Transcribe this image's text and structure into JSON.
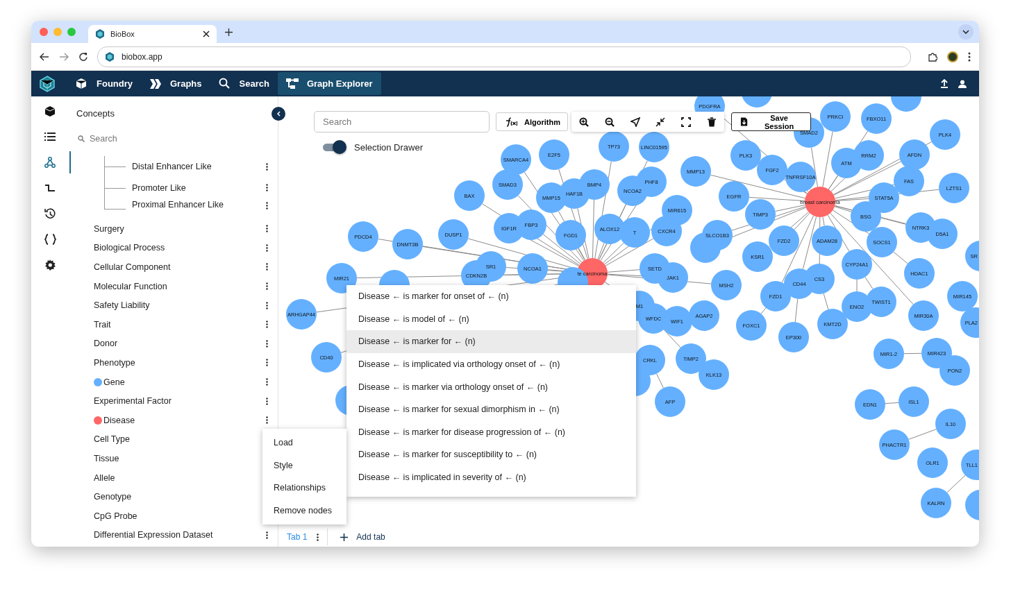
{
  "browser": {
    "tab_title": "BioBox",
    "url": "biobox.app"
  },
  "nav": {
    "items": [
      {
        "label": "Foundry",
        "selected": false
      },
      {
        "label": "Graphs",
        "selected": false
      },
      {
        "label": "Search",
        "selected": false
      },
      {
        "label": "Graph Explorer",
        "selected": true
      }
    ]
  },
  "concepts": {
    "title": "Concepts",
    "search_placeholder": "Search",
    "items": [
      {
        "children": [
          {
            "label": "Distal Enhancer Like"
          },
          {
            "label": "Promoter Like"
          },
          {
            "label": "Proximal Enhancer Like"
          }
        ]
      },
      {
        "label": "Surgery"
      },
      {
        "label": "Biological Process"
      },
      {
        "label": "Cellular Component"
      },
      {
        "label": "Molecular Function"
      },
      {
        "label": "Safety Liability"
      },
      {
        "label": "Trait"
      },
      {
        "label": "Donor"
      },
      {
        "label": "Phenotype"
      },
      {
        "label": "Gene",
        "color": "#64b0ff"
      },
      {
        "label": "Experimental Factor"
      },
      {
        "label": "Disease",
        "color": "#ff6666"
      },
      {
        "label": "Cell Type"
      },
      {
        "label": "Tissue"
      },
      {
        "label": "Allele"
      },
      {
        "label": "Genotype"
      },
      {
        "label": "CpG Probe"
      },
      {
        "label": "Differential Expression Dataset"
      }
    ]
  },
  "graph": {
    "search_placeholder": "Search",
    "algorithm_button": "Algorithm",
    "save_button": "Save Session",
    "selection_drawer": {
      "label": "Selection Drawer",
      "on": true
    },
    "nodes": [
      {
        "label": "te carcinoma",
        "color": "#ff6666"
      },
      {
        "label": "breast carcinoma",
        "color": "#ff6666"
      },
      {
        "label": "SMARCA4",
        "color": "#64b0ff"
      },
      {
        "label": "E2F5",
        "color": "#64b0ff"
      },
      {
        "label": "TP73",
        "color": "#64b0ff"
      },
      {
        "label": "SMAD3",
        "color": "#64b0ff"
      },
      {
        "label": "BAX",
        "color": "#64b0ff"
      },
      {
        "label": "MMP15",
        "color": "#64b0ff"
      },
      {
        "label": "HAF1B",
        "color": "#64b0ff"
      },
      {
        "label": "BMP4",
        "color": "#64b0ff"
      },
      {
        "label": "NCOA2",
        "color": "#64b0ff"
      },
      {
        "label": "IGF1R",
        "color": "#64b0ff"
      },
      {
        "label": "FBP3",
        "color": "#64b0ff"
      },
      {
        "label": "FGD1",
        "color": "#64b0ff"
      },
      {
        "label": "T",
        "color": "#64b0ff"
      },
      {
        "label": "ALOX12",
        "color": "#64b0ff"
      },
      {
        "label": "DUSP1",
        "color": "#64b0ff"
      },
      {
        "label": "PDCD4",
        "color": "#64b0ff"
      },
      {
        "label": "DNMT3B",
        "color": "#64b0ff"
      },
      {
        "label": "MIR21",
        "color": "#64b0ff"
      },
      {
        "label": "SR1",
        "color": "#64b0ff"
      },
      {
        "label": "CDKN2B",
        "color": "#64b0ff"
      },
      {
        "label": "NCOA1",
        "color": "#64b0ff"
      },
      {
        "color": "#64b0ff"
      },
      {
        "label": "PDGFRA",
        "color": "#64b0ff"
      },
      {
        "label": "LINC01595",
        "color": "#64b0ff"
      },
      {
        "label": "PRKCI",
        "color": "#64b0ff"
      },
      {
        "label": "FBXO11",
        "color": "#64b0ff"
      },
      {
        "label": "SMAD2",
        "color": "#64b0ff"
      },
      {
        "label": "PLK4",
        "color": "#64b0ff"
      },
      {
        "label": "PLK3",
        "color": "#64b0ff"
      },
      {
        "label": "FGF2",
        "color": "#64b0ff"
      },
      {
        "label": "TNFRSF10A",
        "color": "#64b0ff"
      },
      {
        "label": "ATM",
        "color": "#64b0ff"
      },
      {
        "label": "RRM2",
        "color": "#64b0ff"
      },
      {
        "label": "AFDN",
        "color": "#64b0ff"
      },
      {
        "label": "MMP13",
        "color": "#64b0ff"
      },
      {
        "label": "PHF8",
        "color": "#64b0ff"
      },
      {
        "label": "MIR615",
        "color": "#64b0ff"
      },
      {
        "label": "EGFR",
        "color": "#64b0ff"
      },
      {
        "label": "TIMP3",
        "color": "#64b0ff"
      },
      {
        "label": "FAS",
        "color": "#64b0ff"
      },
      {
        "label": "LZTS1",
        "color": "#64b0ff"
      },
      {
        "label": "STAT5A",
        "color": "#64b0ff"
      },
      {
        "label": "BSG",
        "color": "#64b0ff"
      },
      {
        "label": "CXCR4",
        "color": "#64b0ff"
      },
      {
        "label": "SLCO1B3",
        "color": "#64b0ff"
      },
      {
        "color": "#64b0ff"
      },
      {
        "label": "FZD2",
        "color": "#64b0ff"
      },
      {
        "label": "ADAM28",
        "color": "#64b0ff"
      },
      {
        "label": "SOCS1",
        "color": "#64b0ff"
      },
      {
        "label": "NTRK3",
        "color": "#64b0ff"
      },
      {
        "label": "D5A1",
        "color": "#64b0ff"
      },
      {
        "label": "SR",
        "color": "#64b0ff"
      },
      {
        "label": "KSR1",
        "color": "#64b0ff"
      },
      {
        "label": "SETD",
        "color": "#64b0ff"
      },
      {
        "label": "JAK1",
        "color": "#64b0ff"
      },
      {
        "label": "CYP24A1",
        "color": "#64b0ff"
      },
      {
        "label": "MSH2",
        "color": "#64b0ff"
      },
      {
        "label": "CD44",
        "color": "#64b0ff"
      },
      {
        "label": "CS3",
        "color": "#64b0ff"
      },
      {
        "label": "FZD1",
        "color": "#64b0ff"
      },
      {
        "label": "HDAC1",
        "color": "#64b0ff"
      },
      {
        "label": "MIR145",
        "color": "#64b0ff"
      },
      {
        "label": "TWIST1",
        "color": "#64b0ff"
      },
      {
        "label": "ENO2",
        "color": "#64b0ff"
      },
      {
        "label": "M1",
        "color": "#64b0ff"
      },
      {
        "label": "WFDC",
        "color": "#64b0ff"
      },
      {
        "label": "WIF1",
        "color": "#64b0ff"
      },
      {
        "label": "AGAP2",
        "color": "#64b0ff"
      },
      {
        "label": "FOXC1",
        "color": "#64b0ff"
      },
      {
        "label": "EP300",
        "color": "#64b0ff"
      },
      {
        "label": "KMT2D",
        "color": "#64b0ff"
      },
      {
        "label": "MIR30A",
        "color": "#64b0ff"
      },
      {
        "label": "PLA2",
        "color": "#64b0ff"
      },
      {
        "label": "CRKL",
        "color": "#64b0ff"
      },
      {
        "label": "TIMP2",
        "color": "#64b0ff"
      },
      {
        "label": "KLK13",
        "color": "#64b0ff"
      },
      {
        "label": "AFP",
        "color": "#64b0ff"
      },
      {
        "color": "#64b0ff"
      },
      {
        "label": "MIR1-2",
        "color": "#64b0ff"
      },
      {
        "label": "MIR423",
        "color": "#64b0ff"
      },
      {
        "label": "PON2",
        "color": "#64b0ff"
      },
      {
        "label": "EDN1",
        "color": "#64b0ff"
      },
      {
        "label": "ISL1",
        "color": "#64b0ff"
      },
      {
        "label": "IL10",
        "color": "#64b0ff"
      },
      {
        "label": "PHACTR1",
        "color": "#64b0ff"
      },
      {
        "label": "OLR1",
        "color": "#64b0ff"
      },
      {
        "label": "TLL1",
        "color": "#64b0ff"
      },
      {
        "label": "KALRN",
        "color": "#64b0ff"
      },
      {
        "label": "ARHGAP44",
        "color": "#64b0ff"
      },
      {
        "label": "CD40",
        "color": "#64b0ff"
      },
      {
        "color": "#64b0ff"
      },
      {
        "color": "#64b0ff"
      },
      {
        "color": "#64b0ff"
      },
      {
        "color": "#64b0ff"
      },
      {
        "color": "#64b0ff"
      }
    ]
  },
  "relationship_menu": {
    "items": [
      {
        "label": "Disease ← is marker for onset of ← (n)",
        "selected": false
      },
      {
        "label": "Disease ← is model of ← (n)",
        "selected": false
      },
      {
        "label": "Disease ← is marker for ← (n)",
        "selected": true
      },
      {
        "label": "Disease ← is implicated via orthology onset of ← (n)",
        "selected": false
      },
      {
        "label": "Disease ← is marker via orthology onset of ← (n)",
        "selected": false
      },
      {
        "label": "Disease ← is marker for sexual dimorphism in ← (n)",
        "selected": false
      },
      {
        "label": "Disease ← is marker for disease progression of ← (n)",
        "selected": false
      },
      {
        "label": "Disease ← is marker for susceptibility to ← (n)",
        "selected": false
      },
      {
        "label": "Disease ← is implicated in severity of ← (n)",
        "selected": false
      }
    ]
  },
  "context_menu": {
    "items": [
      "Load",
      "Style",
      "Relationships",
      "Remove nodes"
    ]
  },
  "bottom_tabs": {
    "tabs": [
      {
        "label": "Tab 1",
        "selected": true
      }
    ],
    "add_label": "Add tab"
  }
}
